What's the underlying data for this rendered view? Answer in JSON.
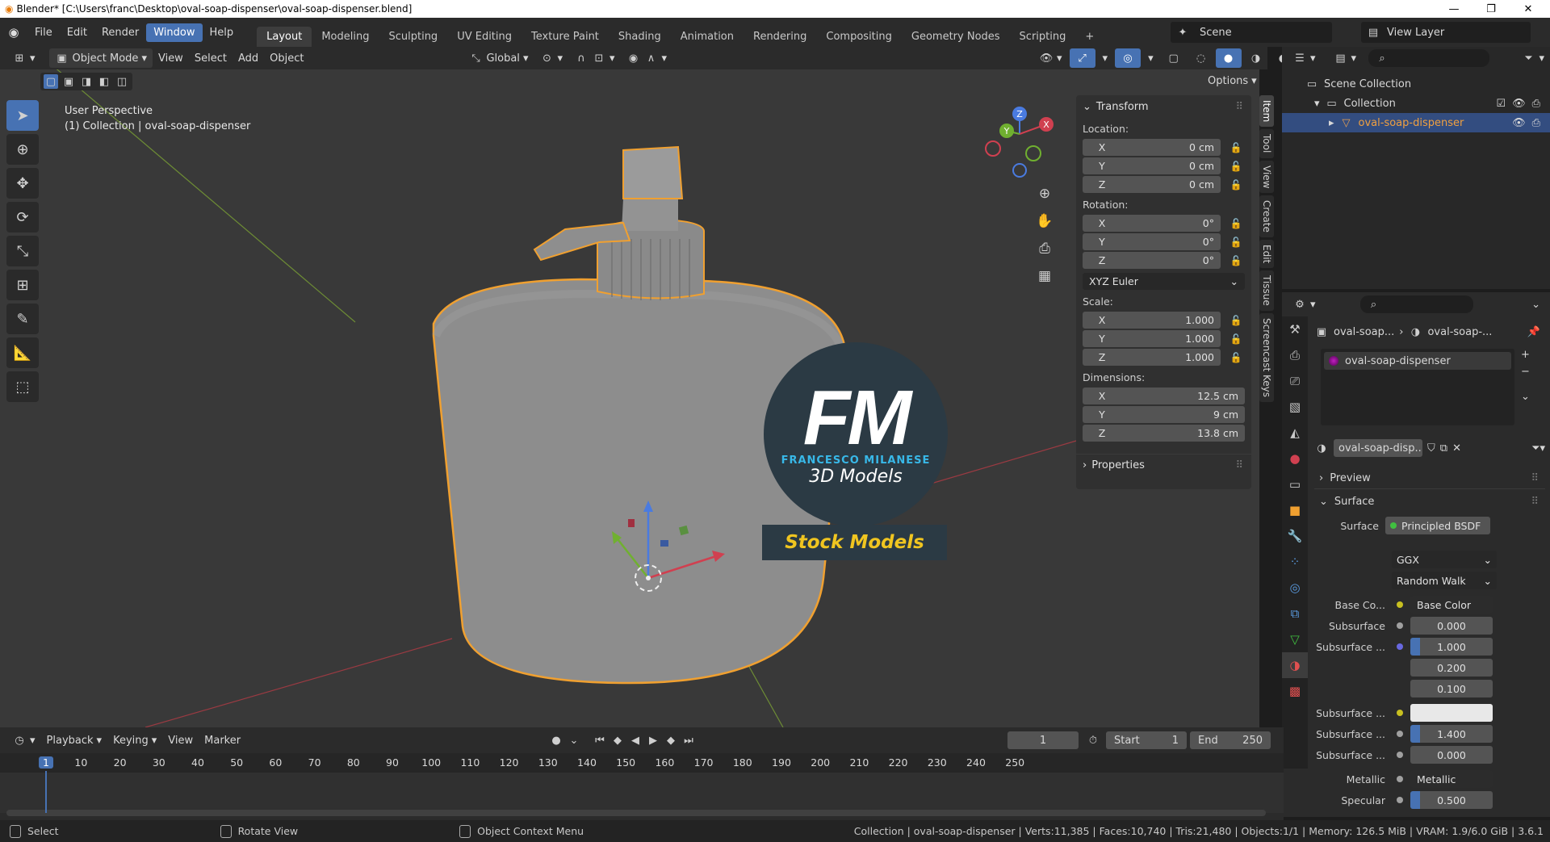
{
  "window": {
    "title": "Blender* [C:\\Users\\franc\\Desktop\\oval-soap-dispenser\\oval-soap-dispenser.blend]",
    "minimize": "—",
    "maximize": "❐",
    "close": "✕"
  },
  "menu": [
    "File",
    "Edit",
    "Render",
    "Window",
    "Help"
  ],
  "workspaces": [
    "Layout",
    "Modeling",
    "Sculpting",
    "UV Editing",
    "Texture Paint",
    "Shading",
    "Animation",
    "Rendering",
    "Compositing",
    "Geometry Nodes",
    "Scripting"
  ],
  "scene": {
    "label": "Scene"
  },
  "view_layer": {
    "label": "View Layer"
  },
  "viewport_header": {
    "mode": "Object Mode",
    "menus": [
      "View",
      "Select",
      "Add",
      "Object"
    ],
    "orientation": "Global",
    "options": "Options"
  },
  "viewport": {
    "perspective": "User Perspective",
    "collection_info": "(1) Collection | oval-soap-dispenser",
    "gizmo_axes": {
      "x": "X",
      "y": "Y",
      "z": "Z"
    }
  },
  "watermark": {
    "logo_letters": "FM",
    "author": "FRANCESCO MILANESE",
    "subtitle": "3D Models",
    "banner": "Stock Models"
  },
  "n_panel": {
    "transform_title": "Transform",
    "location_label": "Location:",
    "location": [
      {
        "axis": "X",
        "value": "0 cm"
      },
      {
        "axis": "Y",
        "value": "0 cm"
      },
      {
        "axis": "Z",
        "value": "0 cm"
      }
    ],
    "rotation_label": "Rotation:",
    "rotation": [
      {
        "axis": "X",
        "value": "0°"
      },
      {
        "axis": "Y",
        "value": "0°"
      },
      {
        "axis": "Z",
        "value": "0°"
      }
    ],
    "rotation_mode": "XYZ Euler",
    "scale_label": "Scale:",
    "scale": [
      {
        "axis": "X",
        "value": "1.000"
      },
      {
        "axis": "Y",
        "value": "1.000"
      },
      {
        "axis": "Z",
        "value": "1.000"
      }
    ],
    "dimensions_label": "Dimensions:",
    "dimensions": [
      {
        "axis": "X",
        "value": "12.5 cm"
      },
      {
        "axis": "Y",
        "value": "9 cm"
      },
      {
        "axis": "Z",
        "value": "13.8 cm"
      }
    ],
    "properties_title": "Properties"
  },
  "vertical_tabs": [
    "Item",
    "Tool",
    "View",
    "Create",
    "Edit",
    "Tissue",
    "Screencast Keys"
  ],
  "outliner": {
    "scene_collection": "Scene Collection",
    "collection": "Collection",
    "object": "oval-soap-dispenser"
  },
  "properties": {
    "breadcrumb_object": "oval-soap...",
    "breadcrumb_material": "oval-soap-...",
    "material_slot": "oval-soap-dispenser",
    "material_name": "oval-soap-disp...",
    "preview": "Preview",
    "surface_section": "Surface",
    "surface_label": "Surface",
    "surface_value": "Principled BSDF",
    "distribution": "GGX",
    "subsurface_method": "Random Walk",
    "rows": [
      {
        "label": "Base Co...",
        "value": "Base Color",
        "dot": "#c8c020"
      },
      {
        "label": "Subsurface",
        "value": "0.000",
        "dot": "#a0a0a0"
      },
      {
        "label": "Subsurface ...",
        "value": "1.000",
        "dot": "#6868e0"
      },
      {
        "label": "",
        "value": "0.200",
        "dot": ""
      },
      {
        "label": "",
        "value": "0.100",
        "dot": ""
      },
      {
        "label": "Subsurface ...",
        "value": "",
        "dot": "#c8c020"
      },
      {
        "label": "Subsurface ...",
        "value": "1.400",
        "dot": "#a0a0a0"
      },
      {
        "label": "Subsurface ...",
        "value": "0.000",
        "dot": "#a0a0a0"
      },
      {
        "label": "Metallic",
        "value": "Metallic",
        "dot": "#a0a0a0"
      },
      {
        "label": "Specular",
        "value": "0.500",
        "dot": "#a0a0a0"
      }
    ]
  },
  "timeline": {
    "menus": [
      "Playback",
      "Keying",
      "View",
      "Marker"
    ],
    "current_frame": "1",
    "start_label": "Start",
    "start": "1",
    "end_label": "End",
    "end": "250",
    "ruler": [
      "1",
      "10",
      "20",
      "30",
      "40",
      "50",
      "60",
      "70",
      "80",
      "90",
      "100",
      "110",
      "120",
      "130",
      "140",
      "150",
      "160",
      "170",
      "180",
      "190",
      "200",
      "210",
      "220",
      "230",
      "240",
      "250"
    ]
  },
  "status": {
    "select": "Select",
    "rotate": "Rotate View",
    "context": "Object Context Menu",
    "stats": "Collection | oval-soap-dispenser | Verts:11,385 | Faces:10,740 | Tris:21,480 | Objects:1/1 | Memory: 126.5 MiB | VRAM: 1.9/6.0 GiB | 3.6.1"
  }
}
